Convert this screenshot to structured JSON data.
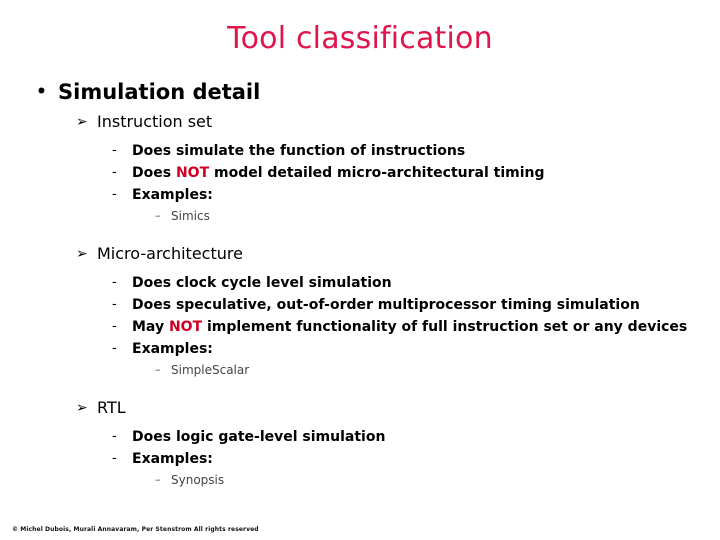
{
  "slide": {
    "title": "Tool classification",
    "bullet_glyphs": {
      "level1": "•",
      "level2": "➢",
      "level3": "-",
      "level4": "–"
    },
    "accent_colors": {
      "title": "#E0154B",
      "emphasis": "#CC0022",
      "body": "#000000",
      "background": "#FFFFFF"
    },
    "outline": {
      "level1_label": "Simulation detail",
      "sections": [
        {
          "heading": "Instruction set",
          "points": [
            {
              "pre": "Does simulate the function of instructions",
              "emphasis": "",
              "post": ""
            },
            {
              "pre": "Does ",
              "emphasis": "NOT",
              "post": " model detailed micro-architectural timing"
            },
            {
              "pre": "Examples:",
              "emphasis": "",
              "post": ""
            }
          ],
          "examples": [
            "Simics"
          ]
        },
        {
          "heading": "Micro-architecture",
          "points": [
            {
              "pre": "Does clock cycle level simulation",
              "emphasis": "",
              "post": ""
            },
            {
              "pre": "Does speculative, out-of-order multiprocessor timing simulation",
              "emphasis": "",
              "post": ""
            },
            {
              "pre": "May ",
              "emphasis": "NOT",
              "post": " implement functionality of full instruction set or any devices"
            },
            {
              "pre": "Examples:",
              "emphasis": "",
              "post": ""
            }
          ],
          "examples": [
            "SimpleScalar"
          ]
        },
        {
          "heading": "RTL",
          "points": [
            {
              "pre": "Does logic gate-level simulation",
              "emphasis": "",
              "post": ""
            },
            {
              "pre": "Examples:",
              "emphasis": "",
              "post": ""
            }
          ],
          "examples": [
            "Synopsis"
          ]
        }
      ]
    },
    "footer": "© Michel Dubois, Murali Annavaram, Per Stenstrom All rights reserved"
  }
}
